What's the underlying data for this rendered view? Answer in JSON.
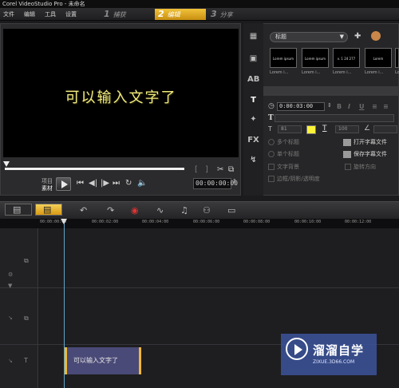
{
  "app": {
    "title": "Corel VideoStudio Pro - 未命名"
  },
  "menu": [
    "文件",
    "编辑",
    "工具",
    "设置"
  ],
  "steps": [
    {
      "num": "1",
      "label": "捕获",
      "active": false
    },
    {
      "num": "2",
      "label": "编辑",
      "active": true
    },
    {
      "num": "3",
      "label": "分享",
      "active": false
    }
  ],
  "player": {
    "overlay_text": "可以输入文字了",
    "project_label": "项目",
    "clip_label": "素材",
    "timecode": "00:00:00:00",
    "bracket_in": "[",
    "bracket_out": "]"
  },
  "library": {
    "category": "标题",
    "thumbnails": [
      {
        "caption": "Lorem i...",
        "preview": "Lorem ipsum"
      },
      {
        "caption": "Lorem i...",
        "preview": "Lorem ipsum"
      },
      {
        "caption": "Lorem i...",
        "preview": "v. 1 24 277"
      },
      {
        "caption": "Lorem i...",
        "preview": "Lorem"
      },
      {
        "caption": "Lorem i...",
        "preview": ""
      }
    ]
  },
  "title_options": {
    "duration": "0:00:03:00",
    "font_size": "81",
    "line_spacing": "100",
    "options": [
      "多个标题",
      "单个标题",
      "文字背景",
      "边框/阴影/透明度"
    ],
    "reverse_label": "旋转方向",
    "open_subtitle": "打开字幕文件",
    "save_subtitle": "保存字幕文件",
    "text_color": "#fcf23a"
  },
  "timeline": {
    "ruler": [
      "00:00:00:00",
      "00:00:02:00",
      "00:00:04:00",
      "00:00:06:00",
      "00:00:08:00",
      "00:00:10:00",
      "00:00:12:00"
    ],
    "title_clip": "可以输入文字了"
  },
  "watermark": {
    "brand": "溜溜自学",
    "url": "ZIXUE.3D66.COM"
  }
}
